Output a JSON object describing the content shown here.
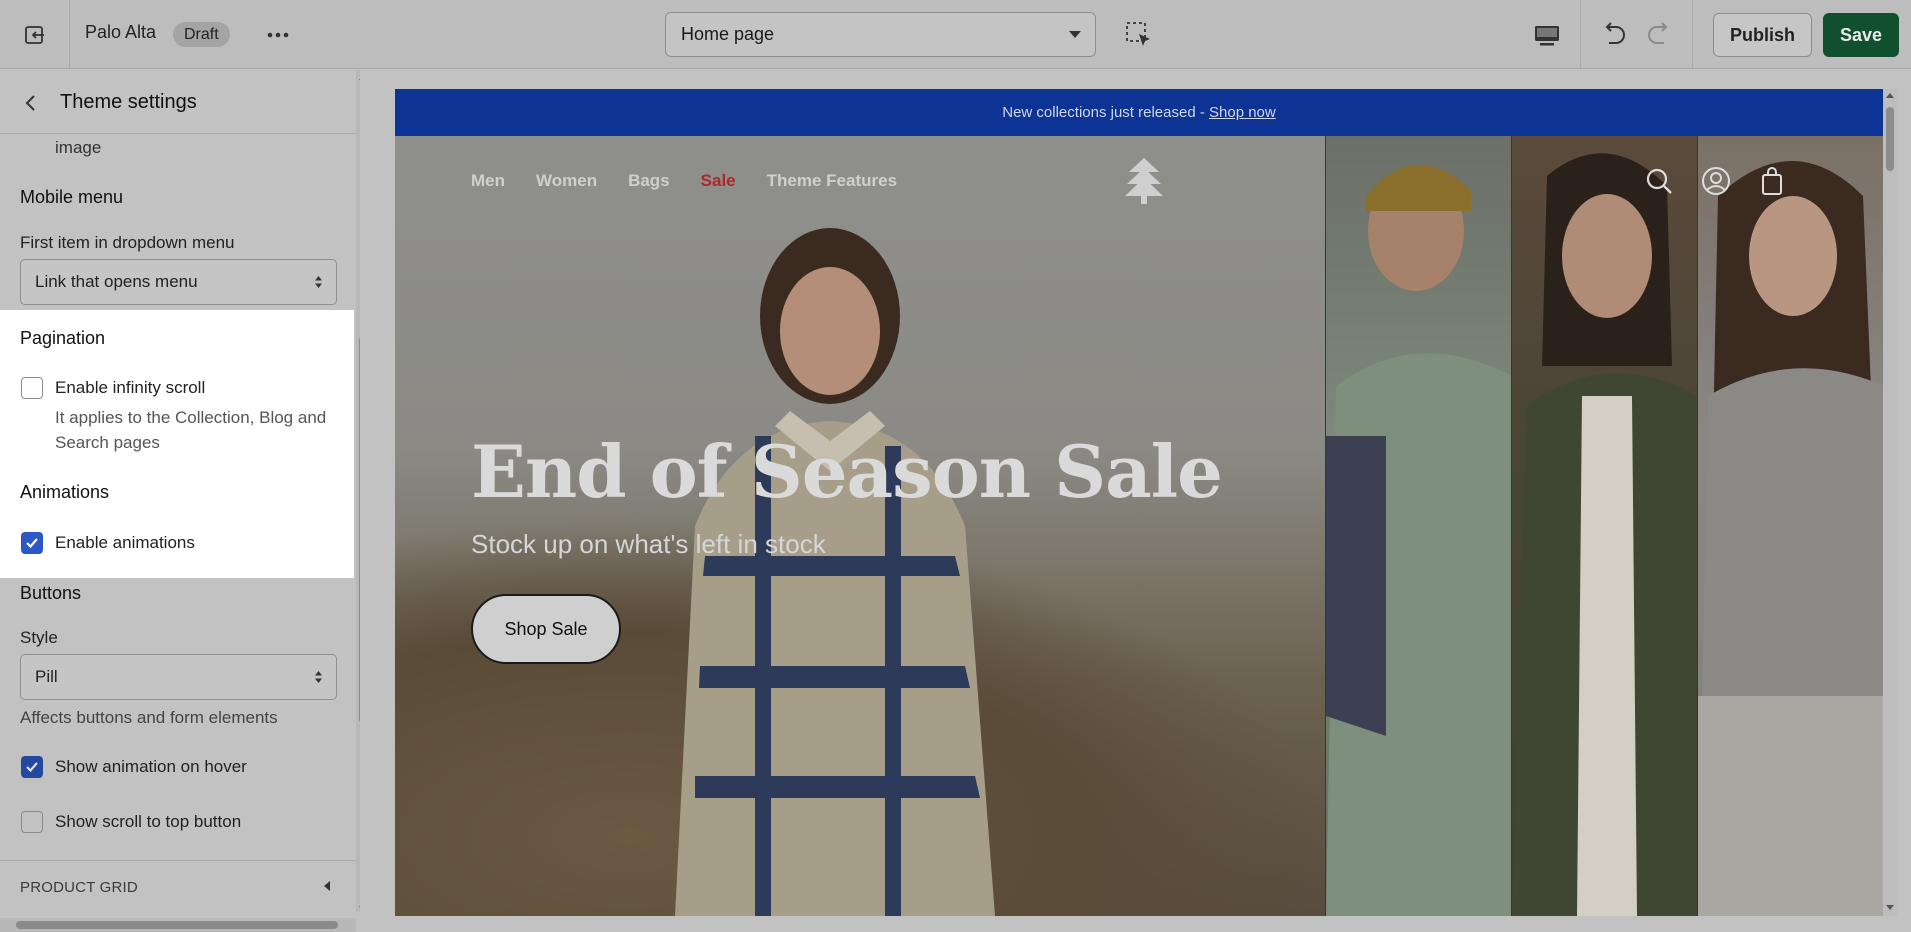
{
  "topbar": {
    "store_name": "Palo Alta",
    "status_badge": "Draft",
    "page_select_value": "Home page",
    "publish_label": "Publish",
    "save_label": "Save"
  },
  "sidebar": {
    "title": "Theme settings",
    "truncated_text": "image",
    "mobile_menu": {
      "heading": "Mobile menu",
      "field_label": "First item in dropdown menu",
      "field_value": "Link that opens menu"
    },
    "pagination": {
      "heading": "Pagination",
      "checkbox_label": "Enable infinity scroll",
      "checked": false,
      "help_line1": "It applies to the Collection, Blog and",
      "help_line2": "Search pages"
    },
    "animations": {
      "heading": "Animations",
      "checkbox_label": "Enable animations",
      "checked": true
    },
    "buttons": {
      "heading": "Buttons",
      "style_label": "Style",
      "style_value": "Pill",
      "help": "Affects buttons and form elements",
      "hover_label": "Show animation on hover",
      "hover_checked": true,
      "scroll_top_label": "Show scroll to top button",
      "scroll_top_checked": false
    },
    "collapsed_section": "PRODUCT GRID"
  },
  "preview": {
    "announcement_text": "New collections just released - ",
    "announcement_link": "Shop now",
    "nav": [
      "Men",
      "Women",
      "Bags",
      "Sale",
      "Theme Features"
    ],
    "hero_title": "End of Season Sale",
    "hero_subtitle": "Stock up on what's left in stock",
    "hero_button": "Shop Sale"
  },
  "colors": {
    "announcement_bg": "#0d3394",
    "save_bg": "#10502f",
    "checkbox_checked": "#2b58c6",
    "sale_link": "#b0272a"
  }
}
